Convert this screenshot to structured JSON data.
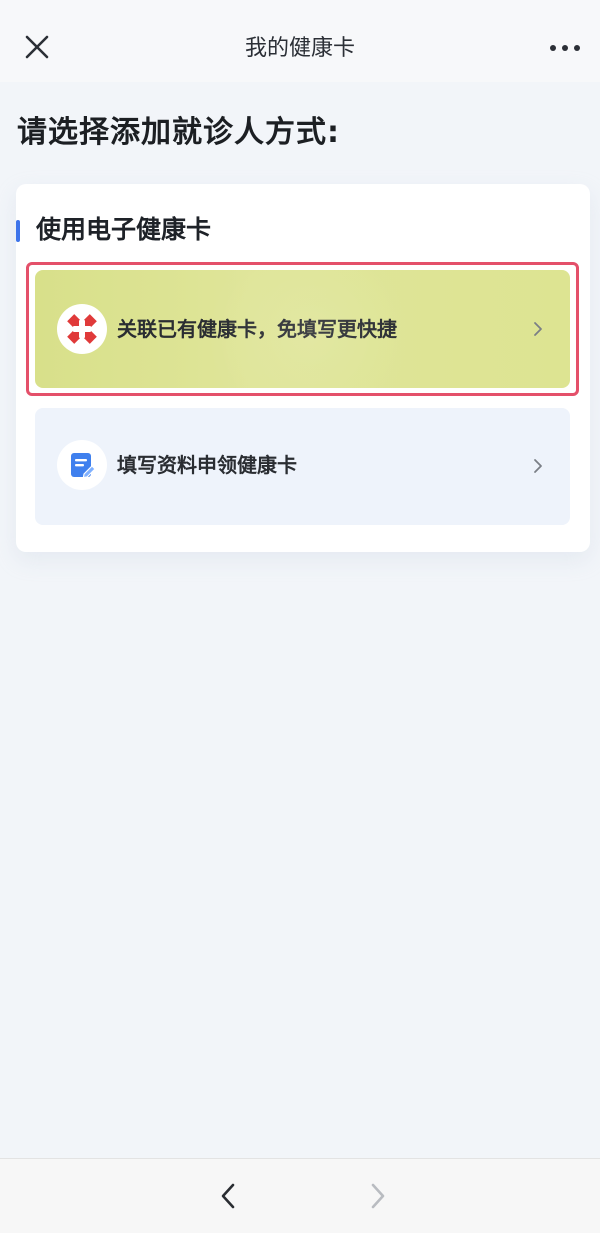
{
  "header": {
    "title": "我的健康卡",
    "close_icon": "close-icon",
    "more_icon": "more-dots-icon"
  },
  "prompt": "请选择添加就诊人方式:",
  "card": {
    "section_title": "使用电子健康卡",
    "options": [
      {
        "label": "关联已有健康卡，免填写更快捷",
        "icon": "medical-cross-icon",
        "highlighted": true
      },
      {
        "label": "填写资料申领健康卡",
        "icon": "form-edit-icon",
        "highlighted": false
      }
    ]
  },
  "bottom_nav": {
    "back_icon": "chevron-left-icon",
    "forward_icon": "chevron-right-icon",
    "forward_enabled": false
  },
  "colors": {
    "accent_blue": "#3e74ea",
    "highlight_red": "#e4506a",
    "option1_bg": "#dde492",
    "option2_bg": "#eef3fb",
    "cross_red": "#e03a3a",
    "page_bg": "#f2f5f9"
  }
}
